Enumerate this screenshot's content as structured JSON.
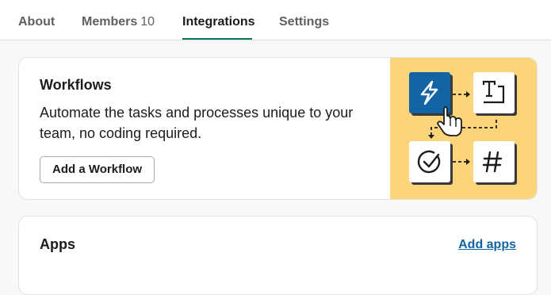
{
  "tabs": [
    {
      "label": "About"
    },
    {
      "label": "Members",
      "count": "10"
    },
    {
      "label": "Integrations"
    },
    {
      "label": "Settings"
    }
  ],
  "active_tab": "Integrations",
  "workflows": {
    "title": "Workflows",
    "description": "Automate the tasks and processes unique to your team, no coding required.",
    "button_label": "Add a Workflow",
    "illustration_icons": [
      "lightning-icon",
      "text-icon",
      "checkmark-icon",
      "hash-icon",
      "pointer-hand-icon"
    ]
  },
  "apps": {
    "title": "Apps",
    "link_label": "Add apps"
  },
  "colors": {
    "accent": "#007a5a",
    "link": "#1264a3",
    "illustration_bg": "#fcd57a",
    "workflow_tile": "#1264a3"
  }
}
